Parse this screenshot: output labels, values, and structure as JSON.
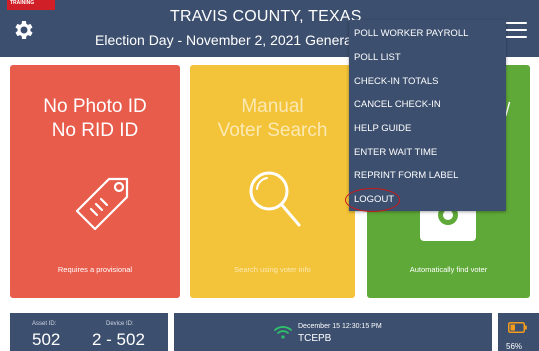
{
  "header": {
    "training_badge": "TRAINING",
    "county": "TRAVIS COUNTY, TEXAS",
    "election": "Election Day - November 2, 2021 General and Special Election"
  },
  "tiles": [
    {
      "title_line1": "No Photo ID",
      "title_line2": "No RID ID",
      "caption": "Requires a provisional",
      "color": "#e85c4c",
      "icon": "tag-icon"
    },
    {
      "title_line1": "Manual",
      "title_line2": "Voter Search",
      "caption": "Search using voter info",
      "color": "#f3c339",
      "icon": "magnifier-icon"
    },
    {
      "title_fragment": "/",
      "caption": "Automatically find voter",
      "color": "#5fa938",
      "icon": "camera-icon"
    }
  ],
  "menu": {
    "items": [
      "POLL WORKER PAYROLL",
      "POLL LIST",
      "CHECK-IN TOTALS",
      "CANCEL CHECK-IN",
      "HELP GUIDE",
      "ENTER WAIT TIME",
      "REPRINT FORM LABEL",
      "LOGOUT"
    ],
    "highlighted": "LOGOUT"
  },
  "footer": {
    "asset_label": "Asset ID:",
    "asset_value": "502",
    "device_label": "Device ID:",
    "device_value": "2 - 502",
    "datetime": "December 15  12:30:15 PM",
    "device_code": "TCEPB",
    "battery_percent": "56%"
  },
  "colors": {
    "header_bg": "#3c4f6e",
    "accent_red": "#e85c4c",
    "accent_yellow": "#f3c339",
    "accent_green": "#5fa938",
    "training_red": "#d01f26",
    "battery_orange": "#f29b1d"
  }
}
